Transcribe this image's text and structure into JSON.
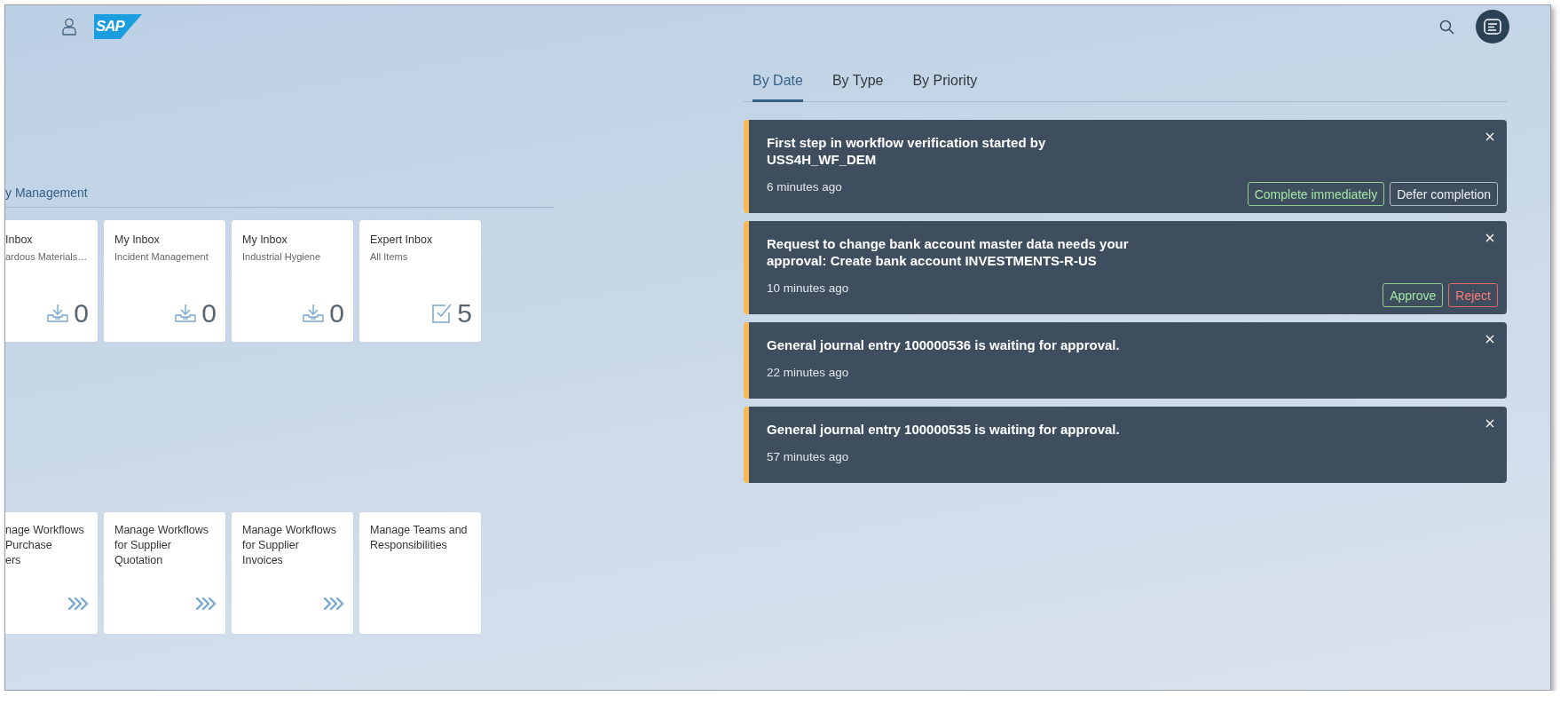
{
  "header": {
    "logo": "SAP"
  },
  "group": {
    "title": "y Management",
    "rows": [
      [
        {
          "kind": "inbox-counter",
          "title": "Inbox",
          "subtitle": "ardous Materials…",
          "count": "0"
        },
        {
          "kind": "inbox-counter",
          "title": "My Inbox",
          "subtitle": "Incident Management",
          "count": "0"
        },
        {
          "kind": "inbox-counter",
          "title": "My Inbox",
          "subtitle": "Industrial Hygiene",
          "count": "0"
        },
        {
          "kind": "task-counter",
          "title": "Expert Inbox",
          "subtitle": "All Items",
          "count": "5"
        }
      ],
      [
        {
          "kind": "launcher",
          "title_lines": [
            "nage Workflows",
            "Purchase",
            "ers"
          ]
        },
        {
          "kind": "launcher",
          "title_lines": [
            "Manage Workflows",
            "for Supplier",
            "Quotation"
          ]
        },
        {
          "kind": "launcher",
          "title_lines": [
            "Manage Workflows",
            "for Supplier",
            "Invoices"
          ]
        },
        {
          "kind": "plain",
          "title_lines": [
            "Manage Teams and",
            "Responsibilities"
          ]
        }
      ]
    ]
  },
  "notifications": {
    "tabs": [
      {
        "label": "By Date",
        "selected": true
      },
      {
        "label": "By Type",
        "selected": false
      },
      {
        "label": "By Priority",
        "selected": false
      }
    ],
    "items": [
      {
        "title_lines": [
          "First step in workflow verification started by",
          "USS4H_WF_DEM"
        ],
        "time": "6 minutes ago",
        "actions": [
          {
            "label": "Complete immediately",
            "kind": "positive"
          },
          {
            "label": "Defer completion",
            "kind": "neutral"
          }
        ]
      },
      {
        "title_lines": [
          "Request to change bank account master data needs your",
          "approval: Create bank account INVESTMENTS-R-US"
        ],
        "time": "10 minutes ago",
        "actions": [
          {
            "label": "Approve",
            "kind": "positive"
          },
          {
            "label": "Reject",
            "kind": "negative"
          }
        ]
      },
      {
        "title_lines": [
          "General journal entry 100000536 is waiting for approval."
        ],
        "time": "22 minutes ago"
      },
      {
        "title_lines": [
          "General journal entry 100000535 is waiting for approval."
        ],
        "time": "57 minutes ago"
      }
    ]
  }
}
